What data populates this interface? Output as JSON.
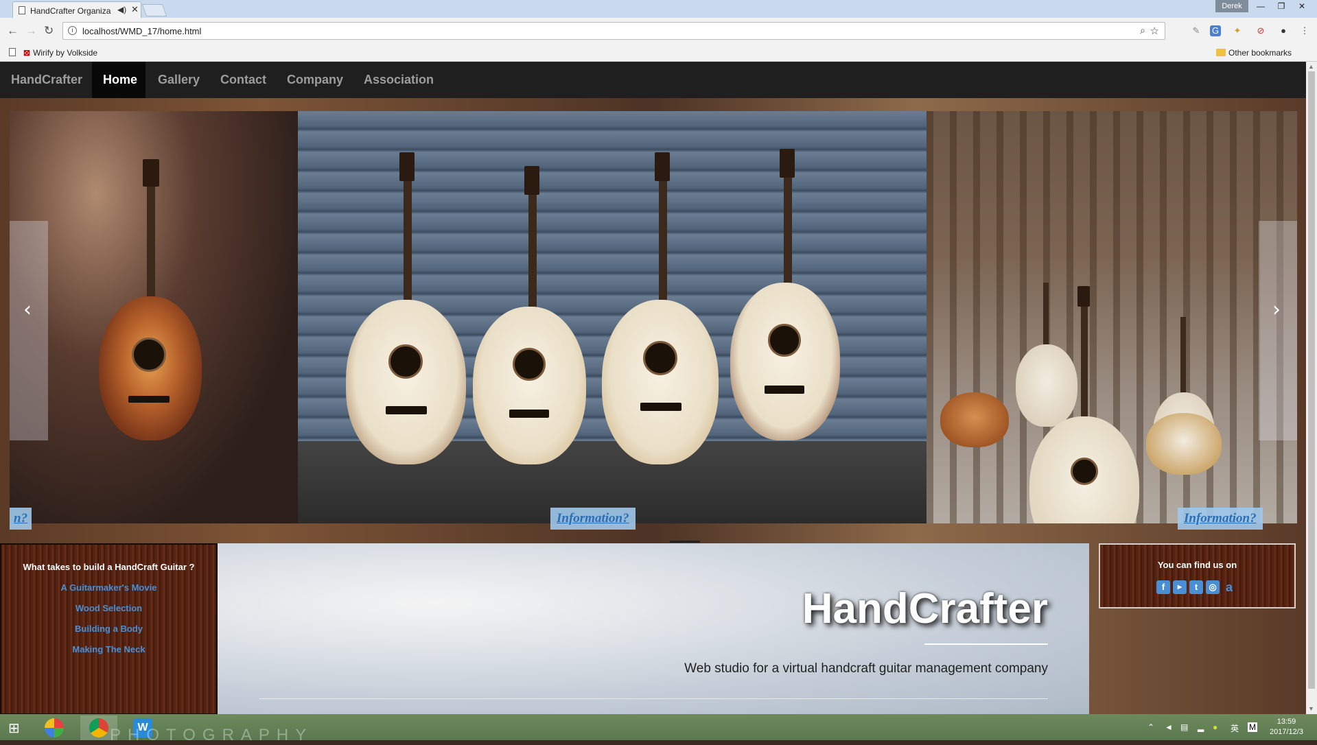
{
  "browser": {
    "tab_title": "HandCrafter Organiza",
    "url": "localhost/WMD_17/home.html",
    "user": "Derek",
    "bookmark": "Wirify by Volkside",
    "other_bookmarks": "Other bookmarks"
  },
  "nav": {
    "brand": "HandCrafter",
    "items": [
      "Home",
      "Gallery",
      "Contact",
      "Company",
      "Association"
    ]
  },
  "carousel": {
    "left_button_partial": "n?",
    "center_button": "Information?",
    "right_button": "Information?"
  },
  "left_panel": {
    "title": "What takes to build a HandCraft Guitar ?",
    "links": [
      "A Guitarmaker's Movie",
      "Wood Selection",
      "Building a Body",
      "Making The Neck"
    ]
  },
  "hero": {
    "title": "HandCrafter",
    "tagline": "Web studio for a virtual handcraft guitar management company"
  },
  "right_panel": {
    "title": "You can find us on",
    "socials": [
      "facebook-icon",
      "youtube-icon",
      "twitter-icon",
      "instagram-icon",
      "amazon-icon"
    ]
  },
  "taskbar": {
    "watermark": "PHOTOGRAPHY",
    "time": "13:59",
    "date": "2017/12/3"
  }
}
